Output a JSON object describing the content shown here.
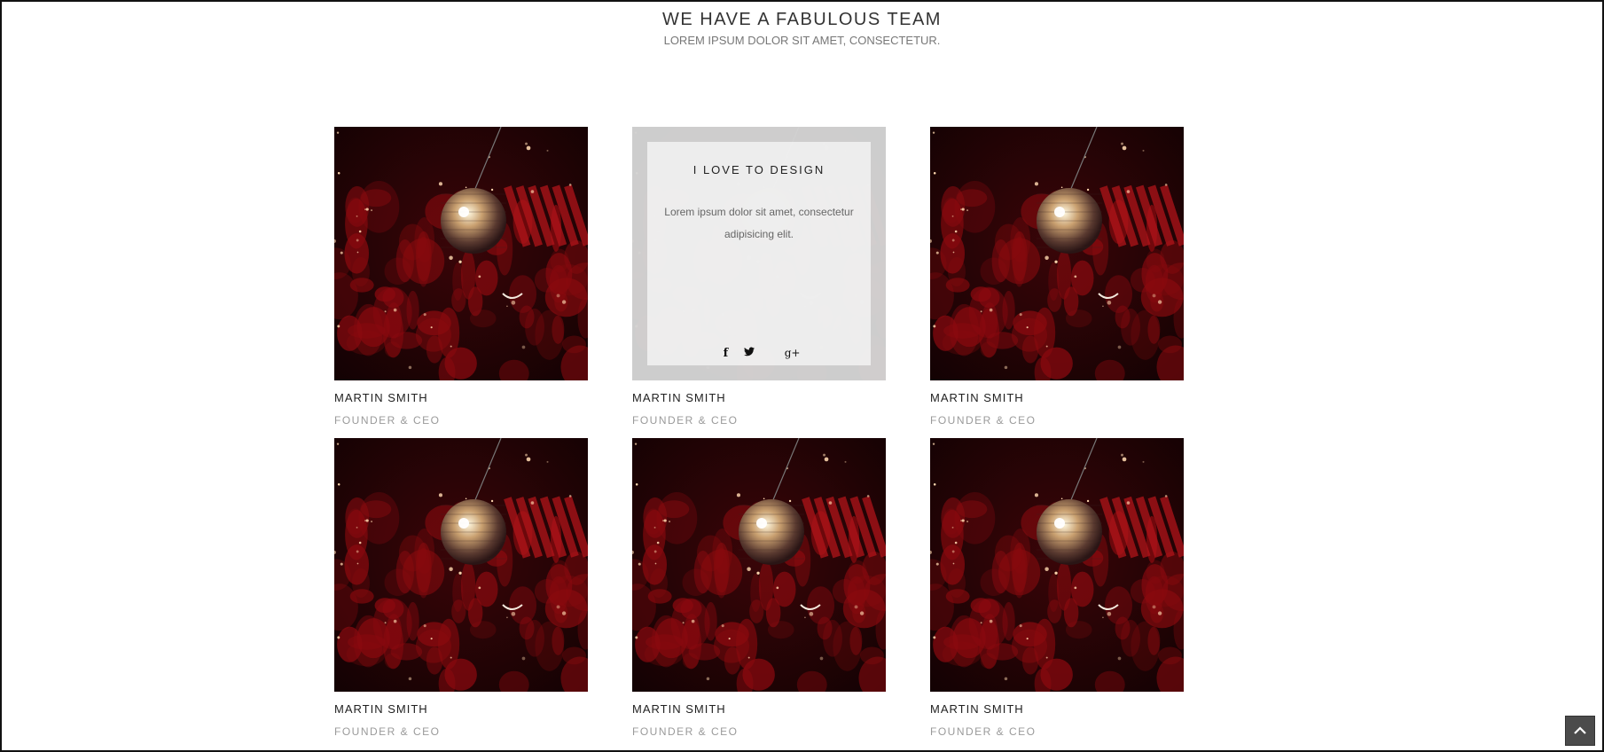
{
  "header": {
    "title": "WE HAVE A FABULOUS TEAM",
    "subtitle": "LOREM IPSUM DOLOR SIT AMET, CONSECTETUR."
  },
  "team": [
    {
      "name": "MARTIN SMITH",
      "role": "FOUNDER & CEO"
    },
    {
      "name": "MARTIN SMITH",
      "role": "FOUNDER & CEO",
      "hover": {
        "title": "I LOVE TO DESIGN",
        "text": "Lorem ipsum dolor sit amet, consectetur adipisicing elit."
      }
    },
    {
      "name": "MARTIN SMITH",
      "role": "FOUNDER & CEO"
    },
    {
      "name": "MARTIN SMITH",
      "role": "FOUNDER & CEO"
    },
    {
      "name": "MARTIN SMITH",
      "role": "FOUNDER & CEO"
    },
    {
      "name": "MARTIN SMITH",
      "role": "FOUNDER & CEO"
    }
  ],
  "social": {
    "facebook": "f",
    "twitter": "🐦",
    "googleplus": "g+"
  },
  "icons": {
    "facebook": "facebook-icon",
    "twitter": "twitter-icon",
    "googleplus": "google-plus-icon",
    "back_to_top": "chevron-up-icon"
  },
  "colors": {
    "photo_dark": "#120203",
    "photo_red": "#8b0a0f",
    "overlay": "#d4d4d4",
    "role_text": "#9a9a9a",
    "back_to_top": "#4b4b4b"
  }
}
